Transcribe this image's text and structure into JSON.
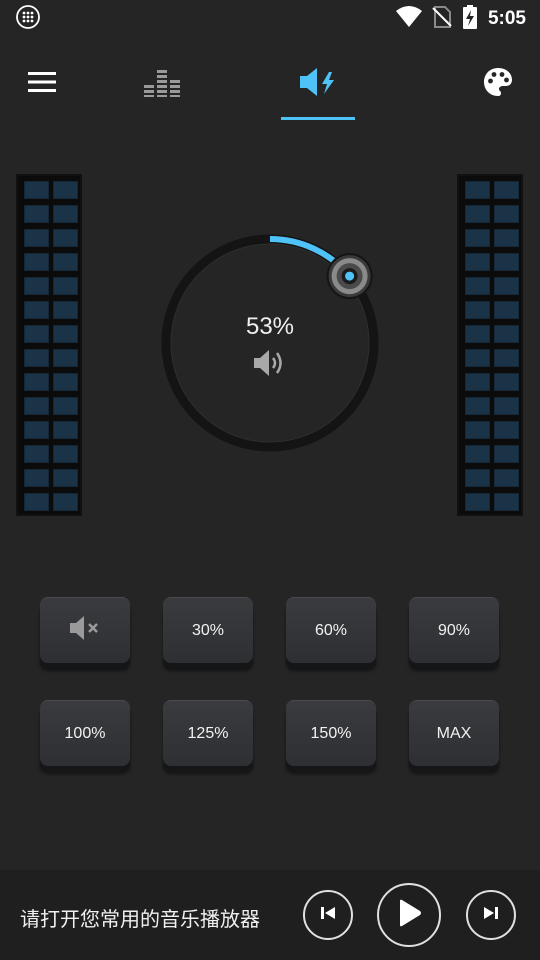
{
  "status_bar": {
    "time": "5:05",
    "icons": [
      "notification-grid-icon",
      "wifi-icon",
      "no-sim-icon",
      "battery-charging-icon"
    ]
  },
  "top_nav": {
    "items": [
      {
        "icon": "menu-icon"
      },
      {
        "icon": "equalizer-icon"
      },
      {
        "icon": "volume-boost-icon",
        "active": true
      },
      {
        "icon": "palette-icon"
      }
    ],
    "accent_color": "#4fc3f7"
  },
  "knob": {
    "value_label": "53%",
    "value": 0.53,
    "icon": "speaker-icon"
  },
  "preset_buttons": [
    {
      "label": "",
      "icon": "mute-icon"
    },
    {
      "label": "30%"
    },
    {
      "label": "60%"
    },
    {
      "label": "90%"
    },
    {
      "label": "100%"
    },
    {
      "label": "125%"
    },
    {
      "label": "150%"
    },
    {
      "label": "MAX"
    }
  ],
  "player": {
    "message": "请打开您常用的音乐播放器",
    "controls": [
      "previous-icon",
      "play-icon",
      "next-icon"
    ]
  }
}
